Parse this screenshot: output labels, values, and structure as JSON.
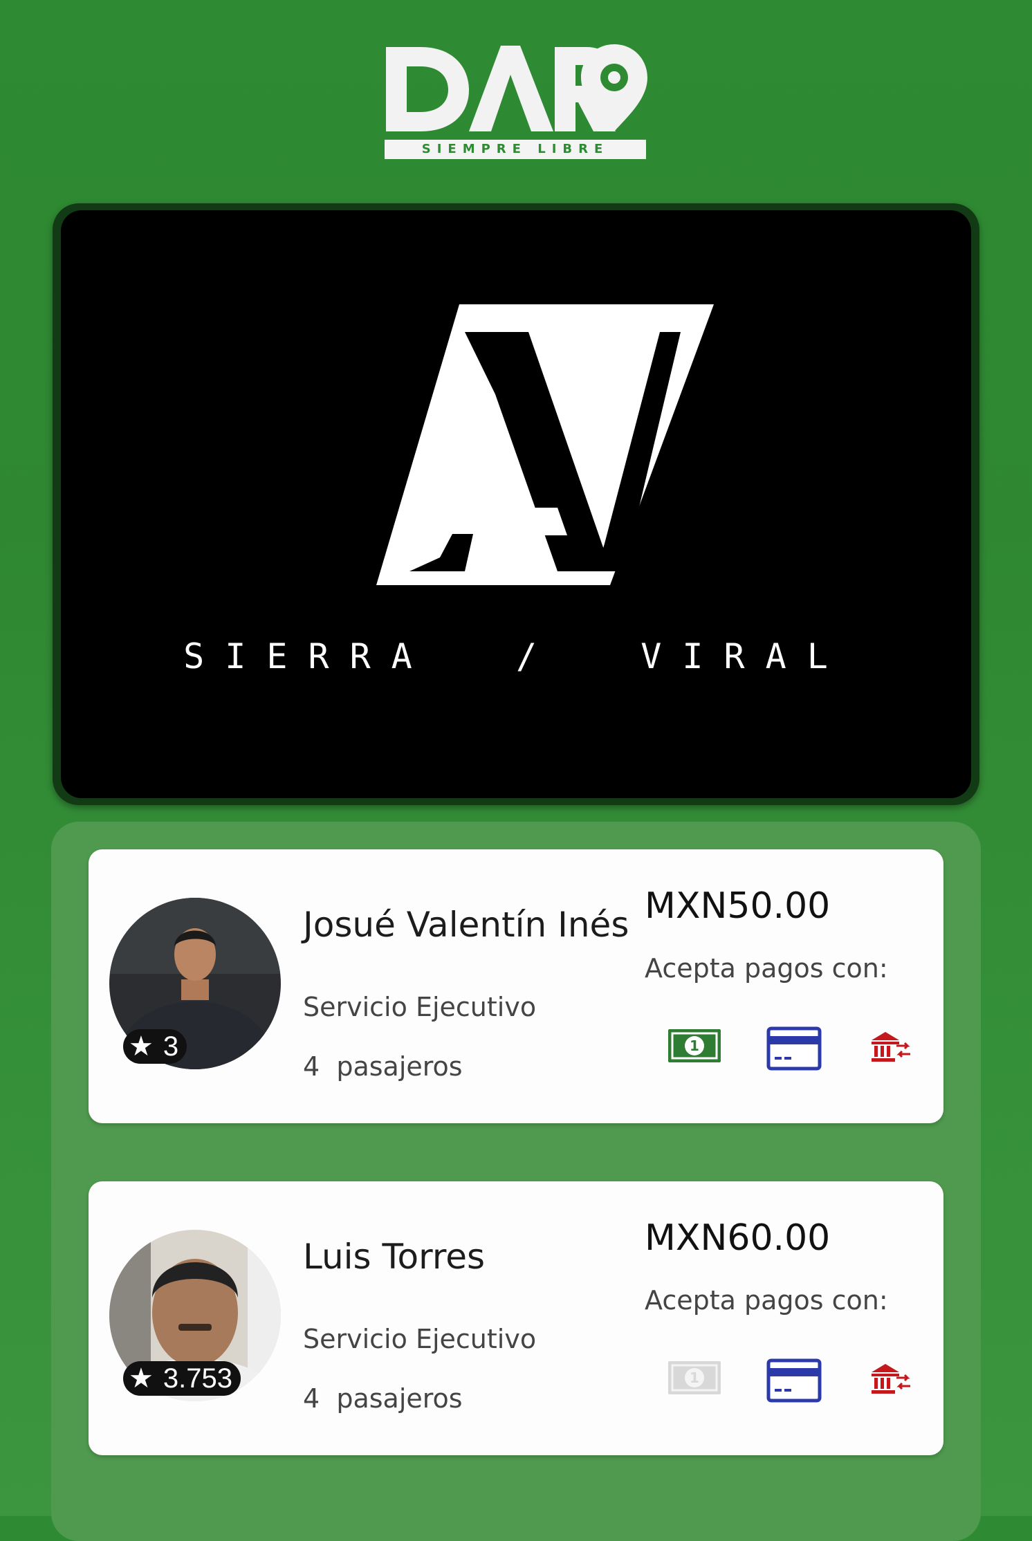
{
  "header": {
    "logo_text": "DARO",
    "tagline": "SIEMPRE LIBRE"
  },
  "banner": {
    "brand_text": "SIERRA  /  VIRAL"
  },
  "drivers": [
    {
      "name": "Josué Valentín Inés",
      "rating": "3",
      "service": "Servicio Ejecutivo",
      "passengers": "4  pasajeros",
      "price": "MXN50.00",
      "payment_label": "Acepta pagos con:",
      "payment_methods": {
        "cash": true,
        "card": true,
        "transfer": true
      }
    },
    {
      "name": "Luis Torres",
      "rating": "3.753",
      "service": "Servicio Ejecutivo",
      "passengers": "4  pasajeros",
      "price": "MXN60.00",
      "payment_label": "Acepta pagos con:",
      "payment_methods": {
        "cash": false,
        "card": true,
        "transfer": true
      }
    }
  ],
  "colors": {
    "background": "#2e8b33",
    "list_panel": "#4f9a4e",
    "cash_enabled": "#2f7d32",
    "cash_disabled": "#d8d8d8",
    "card": "#2b3aa8",
    "transfer": "#c4181c"
  }
}
